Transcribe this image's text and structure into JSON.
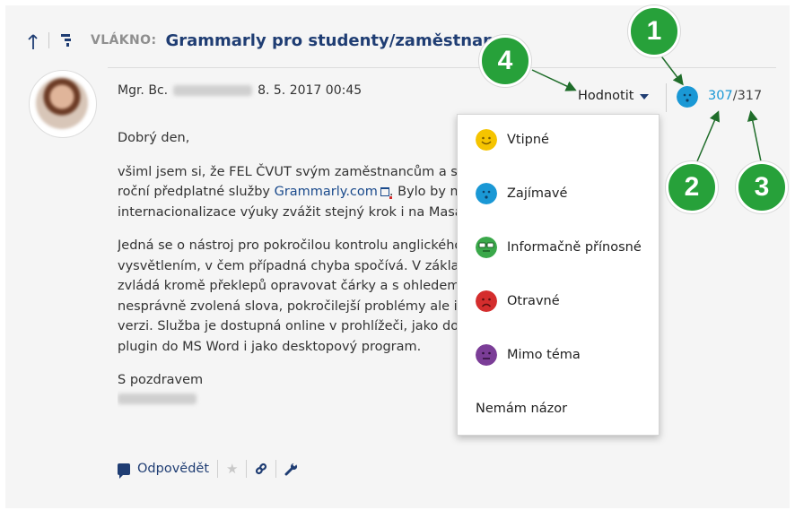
{
  "thread": {
    "label": "VLÁKNO:",
    "title": "Grammarly pro studenty/zaměstnance"
  },
  "post": {
    "author_prefix": "Mgr. Bc.",
    "author_name": "Emmi Rypoli",
    "date": "8. 5. 2017 00:45",
    "greeting": "Dobrý den,",
    "p1_line1": "všiml jsem si, že FEL ČVUT svým zaměstnancům a studentům poskytuje",
    "p1_line2_before": "roční předplatné služby ",
    "p1_link": "Grammarly.com",
    "p1_line2_after": ". Bylo by možné v rámci",
    "p1_line3": "internacionalizace výuky zvážit stejný krok i na Masarykově univerzitě?",
    "p2_line1": "Jedná se o nástroj pro pokročilou kontrolu anglického textu s",
    "p2_line2": "vysvětlením, v čem případná chyba spočívá. V základní verzi",
    "p2_line3": "zvládá kromě překlepů opravovat čárky a s ohledem na kontext",
    "p2_line4": "nesprávně zvolená slova, pokročilejší problémy ale i ve verzi",
    "p2_line5": "verzi. Služba je dostupná online v prohlížeči, jako doplněk prohlížeče,",
    "p2_line6": "plugin do MS Word i jako desktopový program.",
    "closing": "S pozdravem",
    "signature": "Emmi Rypoli"
  },
  "actions": {
    "reply_label": "Odpovědět",
    "icons": [
      "reply-icon",
      "star-icon",
      "link-icon",
      "wrench-icon"
    ]
  },
  "rating": {
    "button_label": "Hodnotit",
    "score": "307",
    "total": "/317",
    "score_color": "#1a98d5"
  },
  "menu": {
    "items": [
      {
        "label": "Vtipné",
        "icon": "smile-icon",
        "color": "#f5c400"
      },
      {
        "label": "Zajímavé",
        "icon": "curious-icon",
        "color": "#1a98d5"
      },
      {
        "label": "Informačně přínosné",
        "icon": "nerd-icon",
        "color": "#3aa84a"
      },
      {
        "label": "Otravné",
        "icon": "sad-icon",
        "color": "#d42d2d"
      },
      {
        "label": "Mimo téma",
        "icon": "neutral-icon",
        "color": "#7b3d97"
      },
      {
        "label": "Nemám názor"
      }
    ]
  },
  "callouts": [
    "1",
    "2",
    "3",
    "4"
  ],
  "colors": {
    "title": "#1f3d73",
    "accent": "#1a98d5",
    "callout": "#27a13a"
  }
}
